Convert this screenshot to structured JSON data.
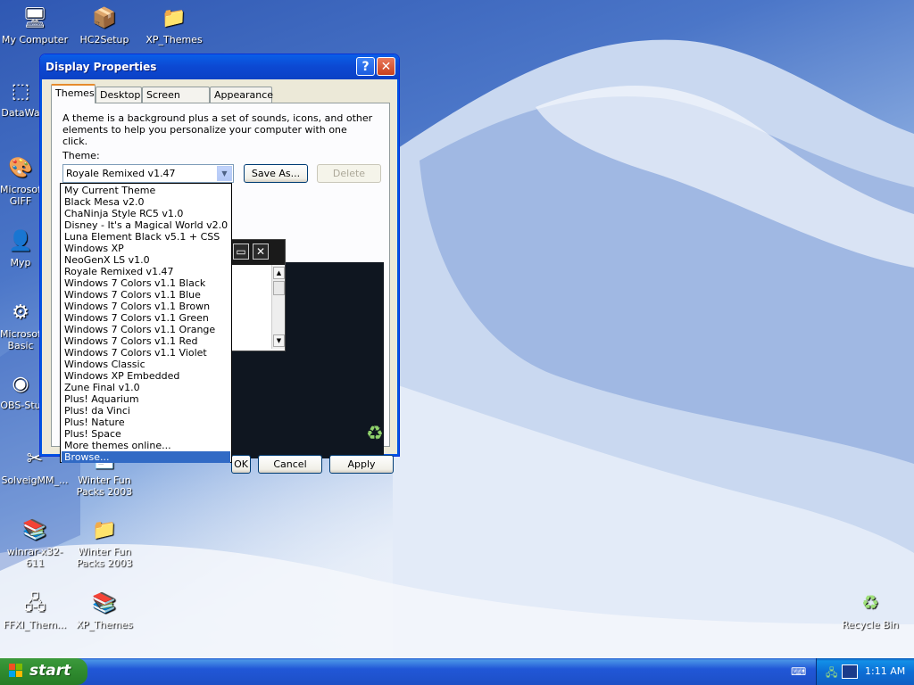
{
  "desktop": {
    "icons": [
      {
        "label": "My Computer",
        "glyph": "🖥"
      },
      {
        "label": "HC2Setup",
        "glyph": "📦"
      },
      {
        "label": "XP_Themes",
        "glyph": "📁"
      },
      {
        "label": "DataWa",
        "glyph": "⬚"
      },
      {
        "label": "Microsof GIFF",
        "glyph": "🎨"
      },
      {
        "label": "Myp",
        "glyph": "👤"
      },
      {
        "label": "Microsof Basic",
        "glyph": "⚙"
      },
      {
        "label": "OBS-Stu",
        "glyph": "◉"
      },
      {
        "label": "SolveigMM_...",
        "glyph": "✂"
      },
      {
        "label": "Winter Fun Packs 2003",
        "glyph": "📄"
      },
      {
        "label": "winrar-x32-611",
        "glyph": "📚"
      },
      {
        "label": "Winter Fun Packs 2003",
        "glyph": "📁"
      },
      {
        "label": "FFXI_Them...",
        "glyph": "🖧"
      },
      {
        "label": "XP_Themes",
        "glyph": "📚"
      },
      {
        "label": "Recycle Bin",
        "glyph": "♻"
      }
    ]
  },
  "window": {
    "title": "Display Properties",
    "help_glyph": "?",
    "close_glyph": "✕",
    "tabs": [
      "Themes",
      "Desktop",
      "Screen Saver",
      "Appearance"
    ],
    "description": "A theme is a background plus a set of sounds, icons, and other elements to help you personalize your computer with one click.",
    "theme_label": "Theme:",
    "theme_value": "Royale Remixed v1.47",
    "save_as": "Save As...",
    "delete": "Delete",
    "ok": "OK",
    "cancel": "Cancel",
    "apply": "Apply",
    "preview_min": "▭",
    "preview_close": "✕"
  },
  "dropdown": {
    "options": [
      "My Current Theme",
      "Black Mesa v2.0",
      "ChaNinja Style RC5 v1.0",
      "Disney - It's a Magical World v2.0",
      "Luna Element Black v5.1 + CSS",
      "Windows XP",
      "NeoGenX LS v1.0",
      "Royale Remixed v1.47",
      "Windows 7 Colors v1.1 Black",
      "Windows 7 Colors v1.1 Blue",
      "Windows 7 Colors v1.1 Brown",
      "Windows 7 Colors v1.1 Green",
      "Windows 7 Colors v1.1 Orange",
      "Windows 7 Colors v1.1 Red",
      "Windows 7 Colors v1.1 Violet",
      "Windows Classic",
      "Windows XP Embedded",
      "Zune Final v1.0",
      "Plus! Aquarium",
      "Plus! da Vinci",
      "Plus! Nature",
      "Plus! Space",
      "More themes online...",
      "Browse..."
    ],
    "selected_index": 23
  },
  "taskbar": {
    "start_label": "start",
    "clock": "1:11 AM",
    "keyboard_glyph": "⌨"
  },
  "colors": {
    "selection": "#316ac5",
    "titlebar": "#0a5fe8",
    "start_green": "#3c9a3c"
  }
}
